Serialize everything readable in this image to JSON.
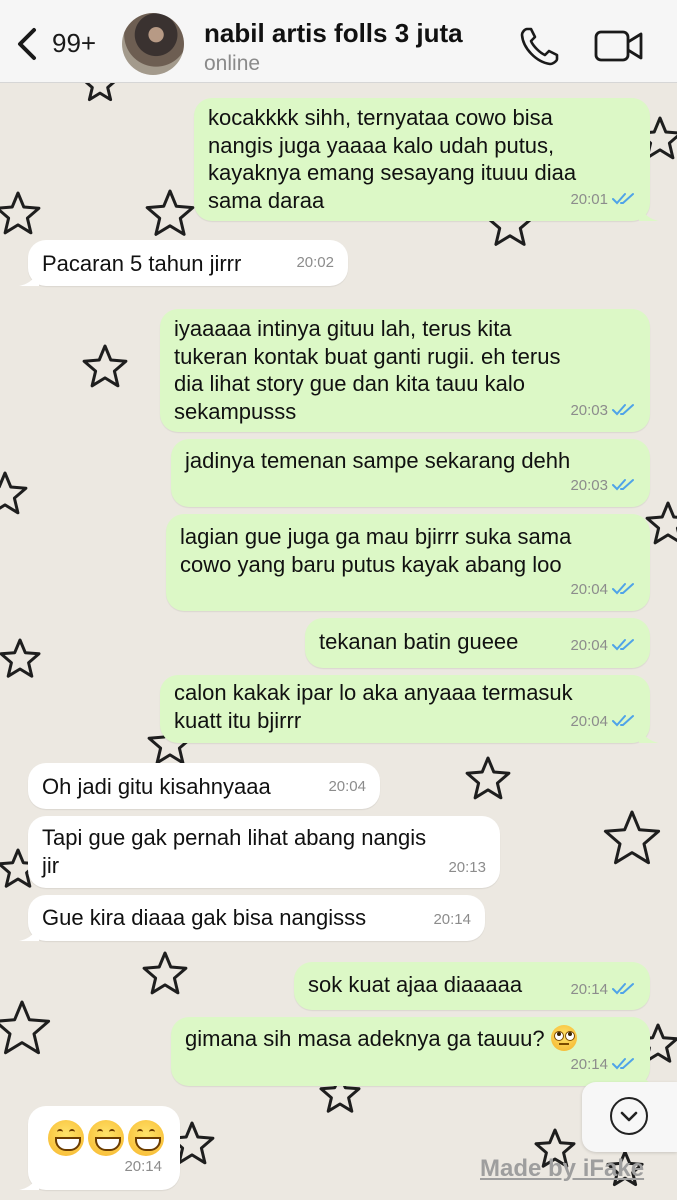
{
  "header": {
    "back_count": "99+",
    "contact_name": "nabil artis folls 3 juta",
    "status": "online"
  },
  "messages": [
    {
      "dir": "out",
      "text": "kocakkkk sihh, ternyataa cowo bisa\nnangis juga yaaaa kalo udah putus,\nkayaknya emang sesayang ituuu diaa\nsama daraa",
      "time": "20:01"
    },
    {
      "dir": "in",
      "text": "Pacaran 5 tahun jirrr",
      "time": "20:02"
    },
    {
      "dir": "out",
      "text": "iyaaaaa intinya gituu lah, terus kita\ntukeran kontak buat ganti rugii. eh terus\ndia lihat story gue dan kita tauu kalo\nsekampusss",
      "time": "20:03"
    },
    {
      "dir": "out",
      "text": "jadinya temenan sampe sekarang dehh",
      "time": "20:03"
    },
    {
      "dir": "out",
      "text": "lagian gue juga ga mau bjirrr suka sama\ncowo yang baru putus kayak abang loo",
      "time": "20:04"
    },
    {
      "dir": "out",
      "text": "tekanan batin gueee",
      "time": "20:04"
    },
    {
      "dir": "out",
      "text": "calon kakak ipar lo aka anyaaa termasuk\nkuatt itu bjirrr",
      "time": "20:04"
    },
    {
      "dir": "in",
      "text": "Oh jadi gitu kisahnyaaa",
      "time": "20:04"
    },
    {
      "dir": "in",
      "text": "Tapi gue gak pernah lihat abang nangis\njir",
      "time": "20:13"
    },
    {
      "dir": "in",
      "text": "Gue kira diaaa gak bisa nangisss",
      "time": "20:14"
    },
    {
      "dir": "out",
      "text": "sok kuat ajaa diaaaaa",
      "time": "20:14"
    },
    {
      "dir": "out",
      "text": "gimana sih masa adeknya ga tauuu?",
      "emoji": "face-with-rolling-eyes",
      "time": "20:14"
    },
    {
      "dir": "in",
      "text": "",
      "emoji": "grinning-face x3",
      "time": "20:14"
    }
  ],
  "colors": {
    "outgoing_bubble": "#dcf8c6",
    "incoming_bubble": "#ffffff",
    "read_ticks": "#4fa3e8",
    "background": "#ece8e1"
  },
  "watermark": "Made by iFake"
}
